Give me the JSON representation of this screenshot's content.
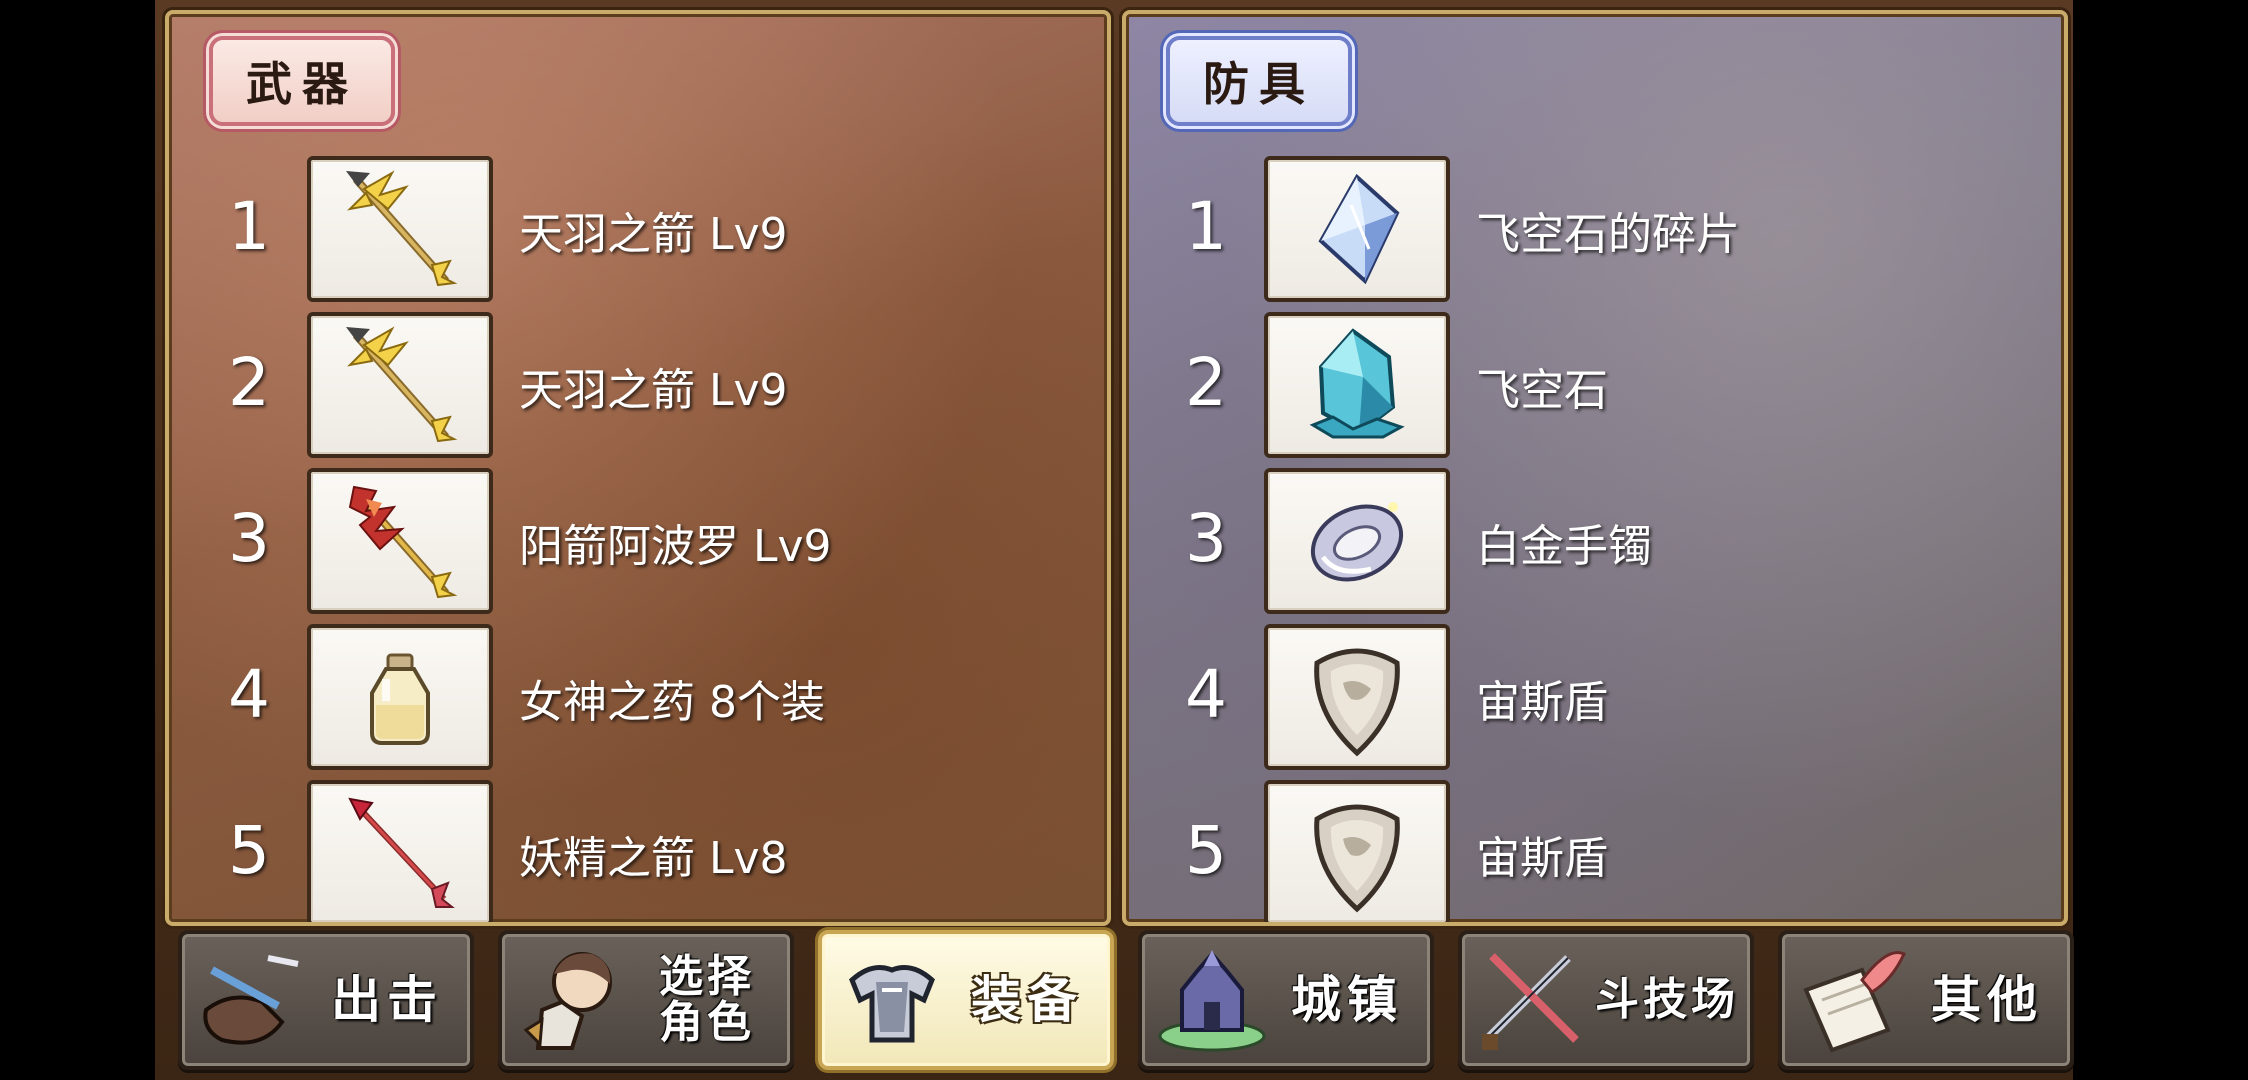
{
  "weapons": {
    "title": "武器",
    "items": [
      {
        "num": "1",
        "name": "天羽之箭 Lv9",
        "icon": "feather-arrow-icon"
      },
      {
        "num": "2",
        "name": "天羽之箭 Lv9",
        "icon": "feather-arrow-icon"
      },
      {
        "num": "3",
        "name": "阳箭阿波罗 Lv9",
        "icon": "flame-arrow-icon"
      },
      {
        "num": "4",
        "name": "女神之药 8个装",
        "icon": "potion-bottle-icon"
      },
      {
        "num": "5",
        "name": "妖精之箭 Lv8",
        "icon": "red-arrow-icon"
      }
    ]
  },
  "armor": {
    "title": "防具",
    "items": [
      {
        "num": "1",
        "name": "飞空石的碎片",
        "icon": "crystal-shard-icon"
      },
      {
        "num": "2",
        "name": "飞空石",
        "icon": "sky-stone-icon"
      },
      {
        "num": "3",
        "name": "白金手镯",
        "icon": "platinum-bracelet-icon"
      },
      {
        "num": "4",
        "name": "宙斯盾",
        "icon": "shield-icon"
      },
      {
        "num": "5",
        "name": "宙斯盾",
        "icon": "shield-icon"
      }
    ]
  },
  "nav": [
    {
      "label": "出击",
      "icon": "sortie-icon",
      "active": false
    },
    {
      "label": "选择\n角色",
      "icon": "character-select-icon",
      "active": false
    },
    {
      "label": "装备",
      "icon": "armor-equip-icon",
      "active": true
    },
    {
      "label": "城镇",
      "icon": "town-icon",
      "active": false
    },
    {
      "label": "斗技场",
      "icon": "arena-swords-icon",
      "active": false
    },
    {
      "label": "其他",
      "icon": "scroll-quill-icon",
      "active": false
    }
  ],
  "colors": {
    "weapons_accent": "#c9707a",
    "armor_accent": "#6e7ec9",
    "frame": "#c9ab6a",
    "active_button": "#f1e7b8"
  }
}
